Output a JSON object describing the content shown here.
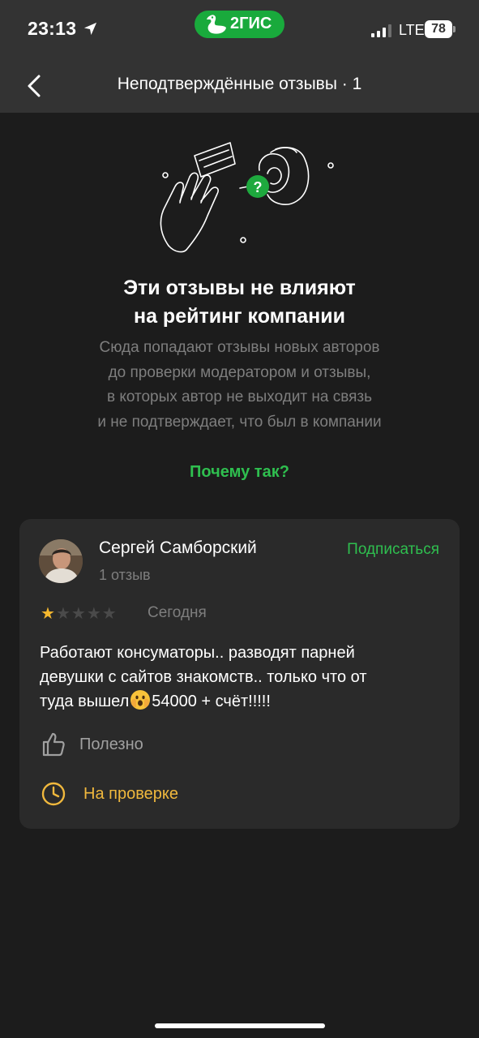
{
  "status_bar": {
    "time": "23:13",
    "network": "LTE",
    "battery": "78",
    "app_badge": "2ГИС"
  },
  "header": {
    "title": "Неподтверждённые отзывы · 1"
  },
  "info": {
    "headline_line1": "Эти отзывы не влияют",
    "headline_line2": "на рейтинг компании",
    "description_lines": [
      "Сюда попадают отзывы новых авторов",
      "до проверки модератором и отзывы,",
      "в которых автор не выходит на связь",
      "и не подтверждает, что был в компании"
    ],
    "why_link": "Почему так?"
  },
  "review": {
    "author_name": "Сергей Самборский",
    "author_reviews": "1 отзыв",
    "subscribe_label": "Подписаться",
    "rating": 1,
    "rating_max": 5,
    "date": "Сегодня",
    "text_line1": "Работают консуматоры.. разводят парней",
    "text_line2": "девушки с сайтов знакомств.. только что от",
    "text_line3_before": "туда вышел",
    "text_line3_after": "54000 + счёт!!!!!",
    "useful_label": "Полезно",
    "status_label": "На проверке"
  },
  "colors": {
    "accent_green": "#2fbf4f",
    "status_yellow": "#f0b83d",
    "star_active": "#f5b82e",
    "star_inactive": "#4a4a4a"
  }
}
